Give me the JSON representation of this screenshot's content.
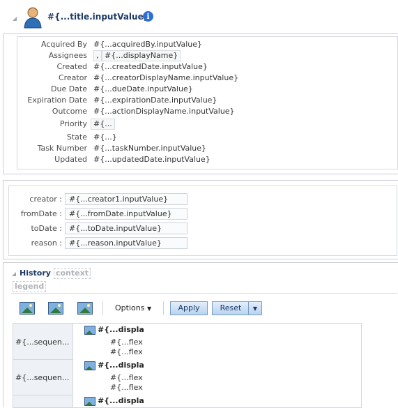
{
  "header": {
    "title": "#{...title.inputValue}",
    "info_icon": "info-icon"
  },
  "details": [
    {
      "label": "Acquired By",
      "value": "#{...acquiredBy.inputValue}"
    },
    {
      "label": "Assignees",
      "value": "#{...displayName}",
      "prefix": ","
    },
    {
      "label": "Created",
      "value": "#{...createdDate.inputValue}"
    },
    {
      "label": "Creator",
      "value": "#{...creatorDisplayName.inputValue}"
    },
    {
      "label": "Due Date",
      "value": "#{...dueDate.inputValue}"
    },
    {
      "label": "Expiration Date",
      "value": "#{...expirationDate.inputValue}"
    },
    {
      "label": "Outcome",
      "value": "#{...actionDisplayName.inputValue}"
    },
    {
      "label": "Priority",
      "value": "#{..."
    },
    {
      "label": "State",
      "value": "#{...}"
    },
    {
      "label": "Task Number",
      "value": "#{...taskNumber.inputValue}"
    },
    {
      "label": "Updated",
      "value": "#{...updatedDate.inputValue}"
    }
  ],
  "params": [
    {
      "label": "creator :",
      "value": "#{...creator1.inputValue}"
    },
    {
      "label": "fromDate :",
      "value": "#{...fromDate.inputValue}"
    },
    {
      "label": "toDate :",
      "value": "#{...toDate.inputValue}"
    },
    {
      "label": "reason :",
      "value": "#{...reason.inputValue}"
    }
  ],
  "history": {
    "title": "History",
    "context": "context",
    "legend": "legend",
    "options_label": "Options",
    "apply_label": "Apply",
    "reset_label": "Reset",
    "rows": [
      {
        "seq": "#{...sequen...",
        "display": "#{...displa",
        "flex1": "#{...flex!",
        "flex2": "#{...flex!"
      },
      {
        "seq": "#{...sequen...",
        "display": "#{...displa",
        "flex1": "#{...flex!",
        "flex2": "#{...flex!"
      },
      {
        "seq": "",
        "display": "#{...displa",
        "flex1": "",
        "flex2": ""
      }
    ]
  },
  "colors": {
    "title": "#1f3a66",
    "accent": "#2d6fd0",
    "button_border": "#7a9cc5"
  }
}
